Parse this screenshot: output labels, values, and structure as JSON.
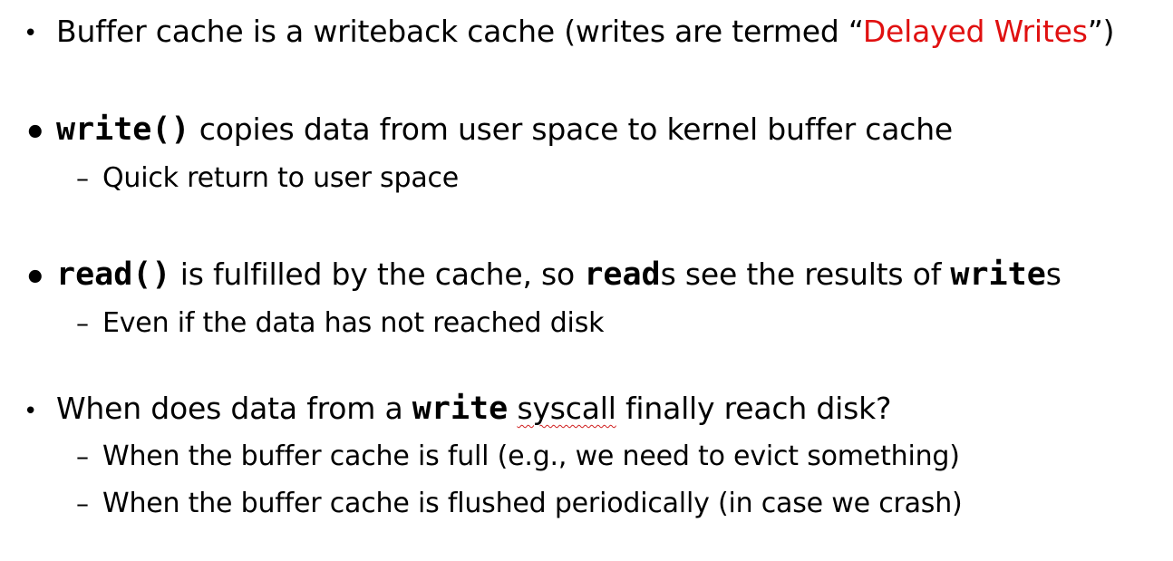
{
  "bullets": [
    {
      "parts": [
        "Buffer cache is a writeback cache (writes are termed “",
        "Delayed Writes",
        "”)"
      ]
    },
    {
      "code": "write()",
      "text": " copies data from user space to kernel buffer cache",
      "subs": [
        "Quick return to user space"
      ]
    },
    {
      "code1": "read()",
      "text1": " is fulfilled by the cache, so ",
      "code2": "read",
      "text2": "s see the results of ",
      "code3": "write",
      "text3": "s",
      "subs": [
        "Even if the data has not reached disk"
      ]
    },
    {
      "text1": "When does data from a ",
      "code": "write",
      "text2": " ",
      "squiggle": "syscall",
      "text3": " finally reach disk?",
      "subs": [
        "When the buffer cache is full (e.g., we need to evict something)",
        "When the buffer cache is flushed periodically (in case we crash)"
      ]
    }
  ],
  "symbols": {
    "bullet": "•",
    "dash": "–"
  }
}
